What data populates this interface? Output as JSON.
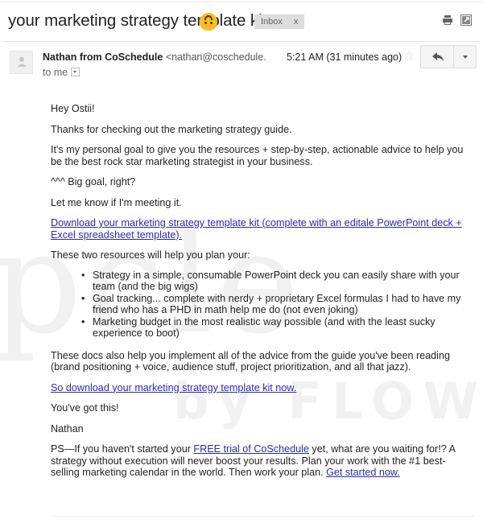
{
  "header": {
    "subject": "your marketing strategy template kit",
    "subject_emoji": "upside-down-face-emoji",
    "label": "Inbox",
    "label_remove": "x",
    "icons": [
      "print-icon",
      "new-window-icon"
    ]
  },
  "message": {
    "sender_name": "Nathan from CoSchedule",
    "sender_address": "<nathan@coschedule.",
    "recipient": "to me",
    "timestamp": "5:21 AM (31 minutes ago)",
    "actions": [
      "star-icon",
      "reply-icon",
      "more-options-icon"
    ]
  },
  "watermark": {
    "line1": "pcle",
    "line2": "by FLOWJI"
  },
  "body": {
    "greeting": "Hey Ostii!",
    "p1": "Thanks for checking out the marketing strategy guide.",
    "p2": "It's my personal goal to give you the resources + step-by-step, actionable advice to help you be the best rock star marketing strategist in your business.",
    "p3": "^^^ Big goal, right?",
    "p4": "Let me know if I'm meeting it.",
    "link1": "Download your marketing strategy template kit (complete with an editale PowerPoint deck + Excel spreadsheet template).",
    "p5": "These two resources will help you plan your:",
    "bullets": [
      "Strategy in a simple, consumable PowerPoint deck you can easily share with your team (and the big wigs)",
      "Goal tracking... complete with nerdy + proprietary Excel formulas I had to have my friend who has a PHD in math help me do (not even joking)",
      "Marketing budget in the most realistic way possible (and with the least sucky experience to boot)"
    ],
    "p6": "These docs also help you implement all of the advice from the guide you've been reading (brand positioning + voice, audience stuff, project prioritization, and all that jazz).",
    "link2": "So download your marketing strategy template kit now.",
    "p7": "You've got this!",
    "signature": "Nathan",
    "ps_prefix": "PS—If you haven't started your ",
    "ps_link1": "FREE trial of CoSchedule",
    "ps_middle": " yet, what are you waiting for!? A strategy without execution will never boost your results. Plan your work with the #1 best-selling marketing calendar in the world. Then work your plan. ",
    "ps_link2": "Get started now."
  },
  "colors": {
    "link": "#2a2ab5",
    "label_bg": "#dddddd",
    "emoji": "#f6bd24"
  }
}
